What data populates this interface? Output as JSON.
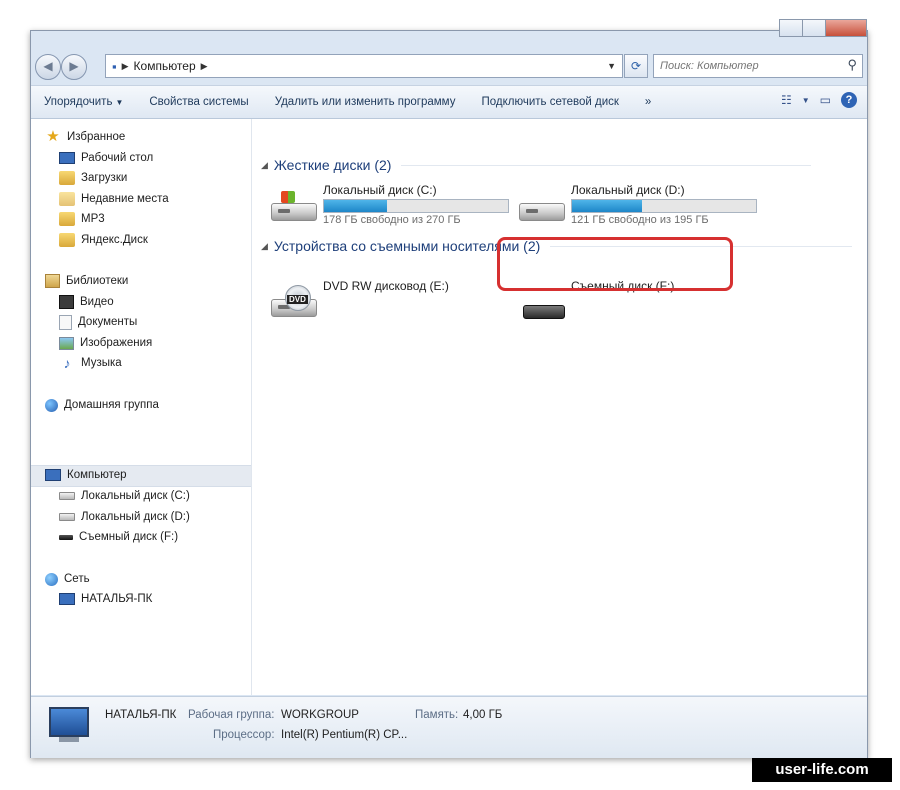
{
  "address": {
    "path": "Компьютер"
  },
  "search": {
    "placeholder": "Поиск: Компьютер"
  },
  "toolbar": {
    "organize": "Упорядочить",
    "system_properties": "Свойства системы",
    "uninstall": "Удалить или изменить программу",
    "map_drive": "Подключить сетевой диск",
    "more": "»"
  },
  "sidebar": {
    "favorites": {
      "label": "Избранное",
      "items": [
        "Рабочий стол",
        "Загрузки",
        "Недавние места",
        "MP3",
        "Яндекс.Диск"
      ]
    },
    "libraries": {
      "label": "Библиотеки",
      "items": [
        "Видео",
        "Документы",
        "Изображения",
        "Музыка"
      ]
    },
    "homegroup": "Домашняя группа",
    "computer": {
      "label": "Компьютер",
      "items": [
        "Локальный диск (C:)",
        "Локальный диск (D:)",
        "Съемный диск (F:)"
      ]
    },
    "network": {
      "label": "Сеть",
      "items": [
        "НАТАЛЬЯ-ПК"
      ]
    }
  },
  "groups": {
    "hard_drives": "Жесткие диски (2)",
    "removable": "Устройства со съемными носителями (2)"
  },
  "drives": {
    "c": {
      "name": "Локальный диск (C:)",
      "free": "178 ГБ свободно из 270 ГБ",
      "used_fraction": 0.34
    },
    "d": {
      "name": "Локальный диск (D:)",
      "free": "121 ГБ свободно из 195 ГБ",
      "used_fraction": 0.38
    },
    "e": {
      "name": "DVD RW дисковод (E:)",
      "badge": "DVD"
    },
    "f": {
      "name": "Съемный диск (F:)"
    }
  },
  "details": {
    "computer_name": "НАТАЛЬЯ-ПК",
    "workgroup_label": "Рабочая группа:",
    "workgroup": "WORKGROUP",
    "memory_label": "Память:",
    "memory": "4,00 ГБ",
    "cpu_label": "Процессор:",
    "cpu": "Intel(R) Pentium(R) CP..."
  },
  "watermark": "user-life.com",
  "colors": {
    "highlight": "#d63030",
    "bar_fill": "#1e86c8"
  }
}
